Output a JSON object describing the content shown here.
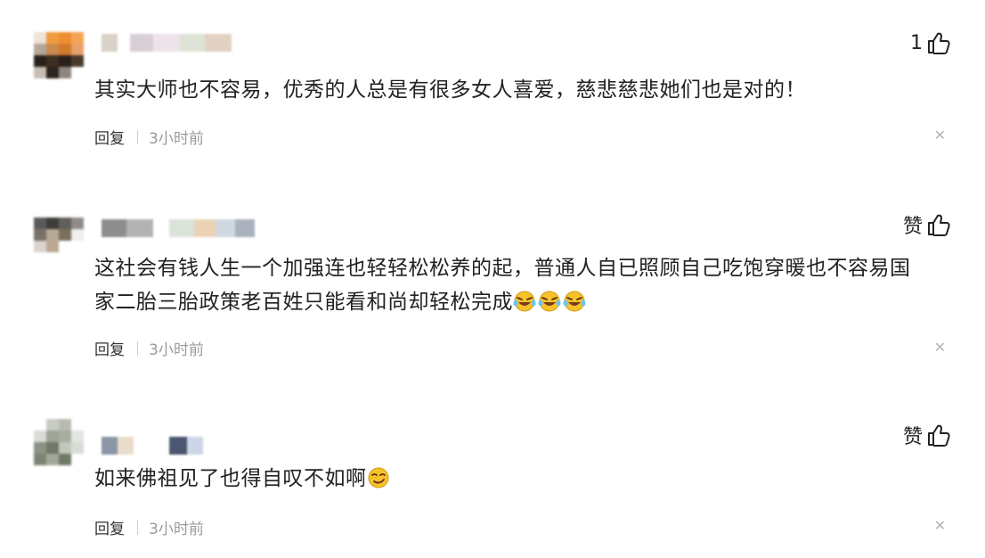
{
  "colors": {
    "text": "#222222",
    "muted": "#9a9a9a",
    "icon": "#222222",
    "emoji": "#f6c22b"
  },
  "comments": [
    {
      "like_count": "1",
      "text": "其实大师也不容易，优秀的人总是有很多女人喜爱，慈悲慈悲她们也是对的！",
      "reply_label": "回复",
      "time": "3小时前",
      "close_icon": "close-icon"
    },
    {
      "like_label": "赞",
      "text_line1": "这社会有钱人生一个加强连也轻轻松松养的起，普通人自已照顾自己吃饱穿暖也不容易国",
      "text_line2": "家二胎三胎政策老百姓只能看和尚却轻松完成",
      "emoji_names": [
        "laughing-crying-emoji",
        "laughing-crying-emoji",
        "laughing-crying-emoji"
      ],
      "reply_label": "回复",
      "time": "3小时前",
      "close_icon": "close-icon"
    },
    {
      "like_label": "赞",
      "text": "如来佛祖见了也得自叹不如啊",
      "emoji_names": [
        "smirk-emoji"
      ],
      "reply_label": "回复",
      "time": "3小时前",
      "close_icon": "close-icon"
    }
  ]
}
